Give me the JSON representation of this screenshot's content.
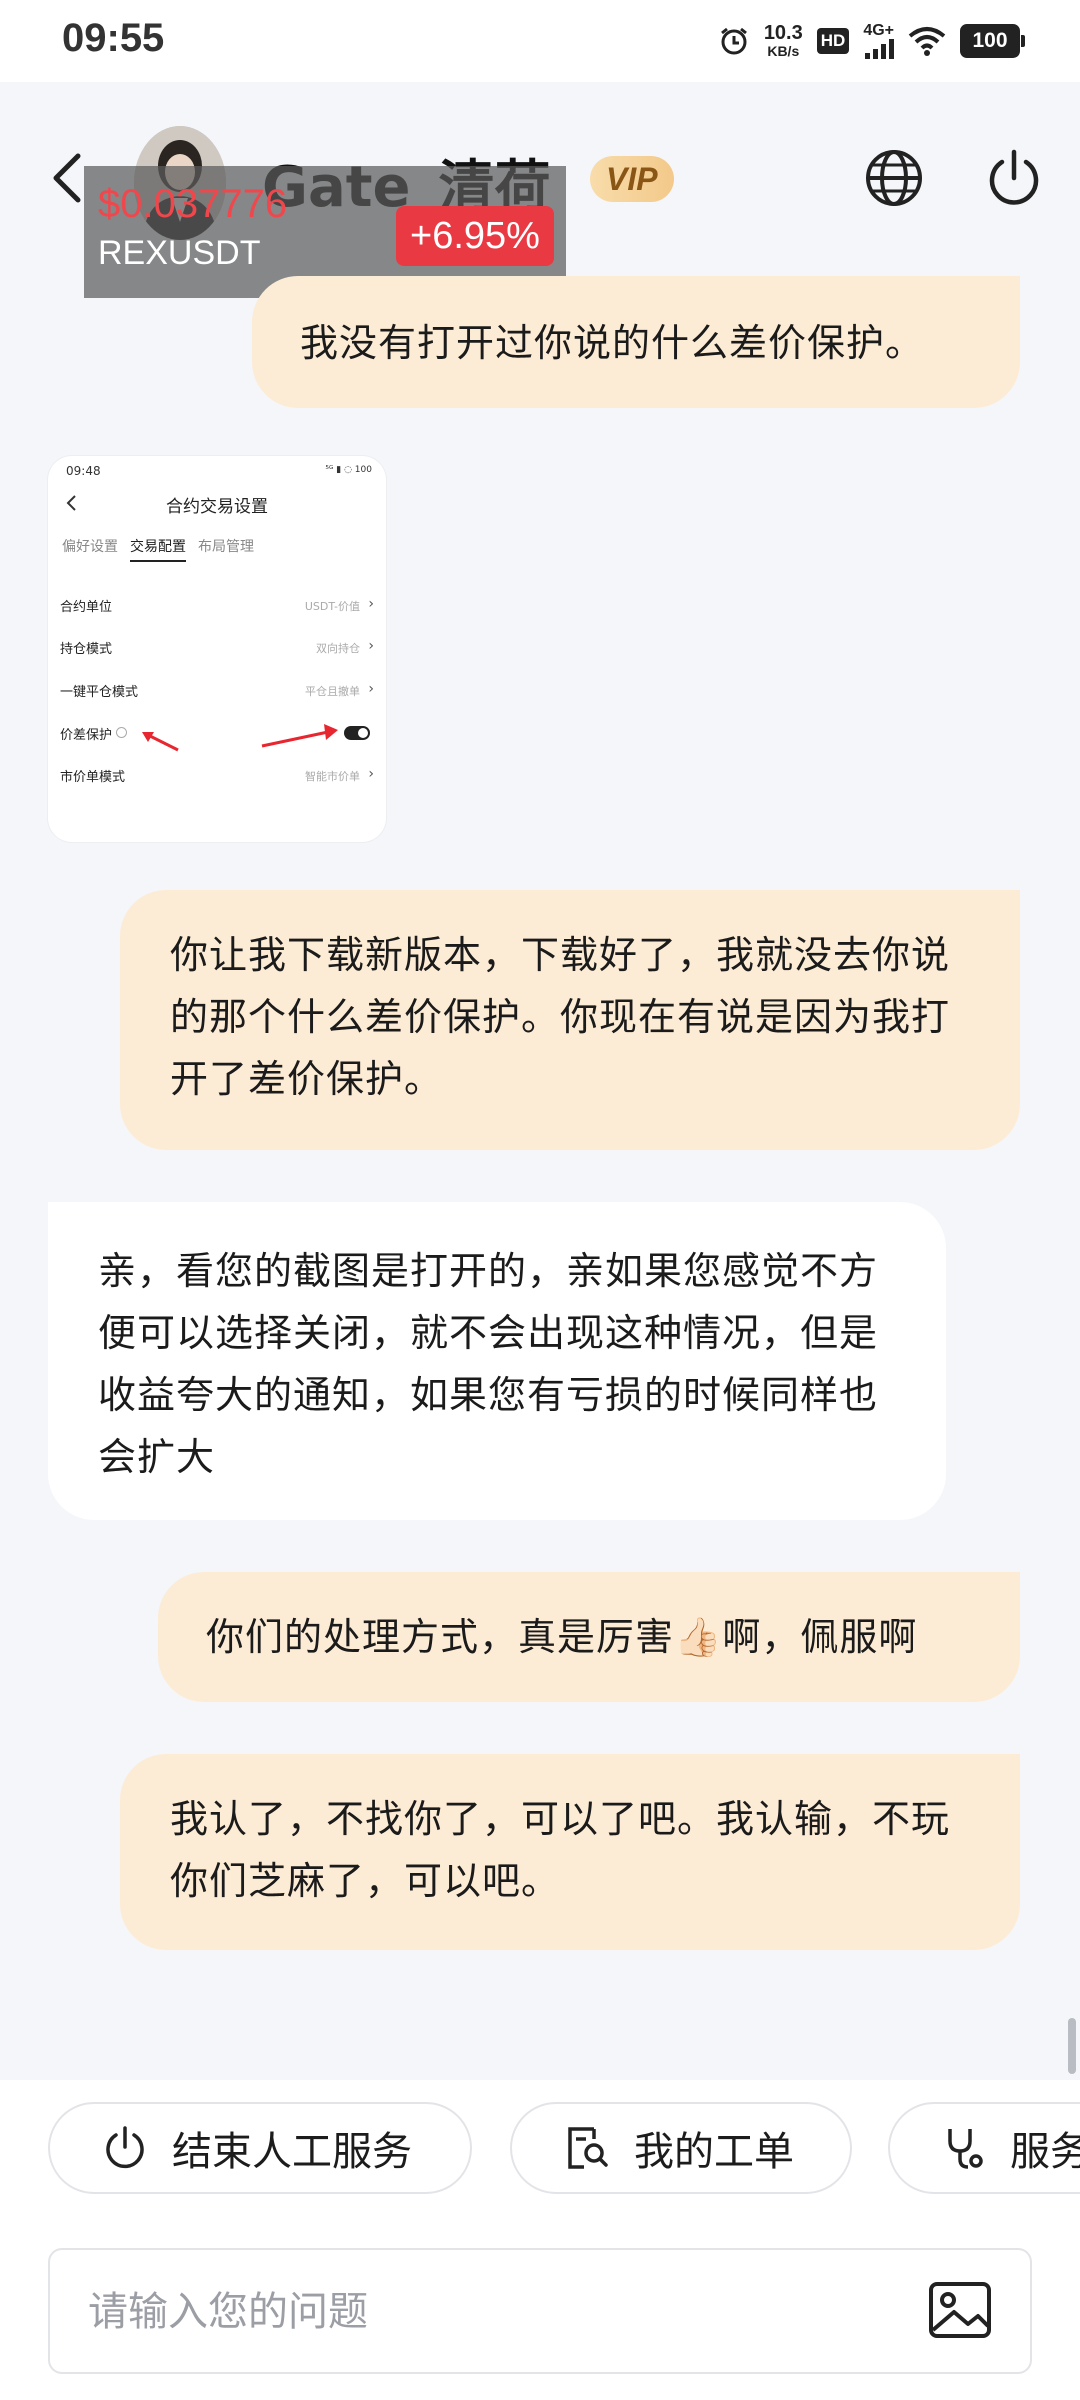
{
  "status_bar": {
    "time": "09:55",
    "net_speed_value": "10.3",
    "net_speed_unit": "KB/s",
    "hd_label": "HD",
    "network_type": "4G+",
    "battery": "100"
  },
  "header": {
    "agent_name": "Gate_清荷",
    "vip_label": "VIP"
  },
  "ticker": {
    "price": "$0.037776",
    "symbol": "REXUSDT",
    "change": "+6.95%"
  },
  "messages": [
    {
      "role": "user",
      "text": "我没有打开过你说的什么差价保护。"
    },
    {
      "role": "user",
      "text": "你让我下载新版本，下载好了，我就没去你说的那个什么差价保护。你现在有说是因为我打开了差价保护。"
    },
    {
      "role": "agent",
      "text": "亲，看您的截图是打开的，亲如果您感觉不方便可以选择关闭，就不会出现这种情况，但是收益夸大的通知，如果您有亏损的时候同样也会扩大"
    },
    {
      "role": "user",
      "text": "你们的处理方式，真是厉害👍🏻啊，佩服啊"
    },
    {
      "role": "user",
      "text": "我认了，不找你了，可以了吧。我认输，不玩你们芝麻了，可以吧。"
    }
  ],
  "screenshot": {
    "time": "09:48",
    "status": "⁵ᴳ ▮ ◌ 100",
    "title": "合约交易设置",
    "tabs": [
      "偏好设置",
      "交易配置",
      "布局管理"
    ],
    "rows": [
      {
        "label": "合约单位",
        "value": "USDT-价值"
      },
      {
        "label": "持仓模式",
        "value": "双向持仓"
      },
      {
        "label": "一键平仓模式",
        "value": "平仓且撤单"
      },
      {
        "label": "价差保护",
        "value": ""
      },
      {
        "label": "市价单模式",
        "value": "智能市价单"
      }
    ]
  },
  "quick_actions": {
    "end_service": "结束人工服务",
    "my_tickets": "我的工单",
    "service": "服务"
  },
  "input": {
    "placeholder": "请输入您的问题"
  }
}
